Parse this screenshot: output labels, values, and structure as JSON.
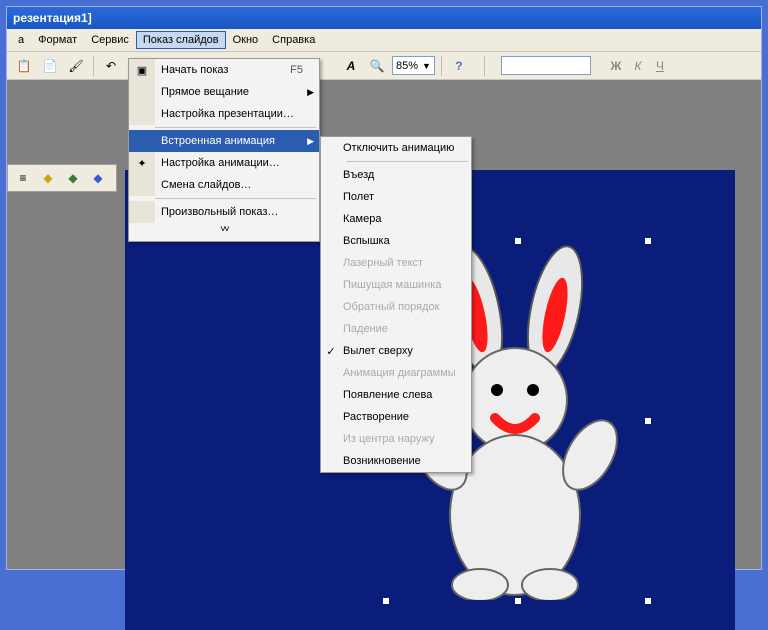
{
  "titlebar": "резентация1]",
  "menubar": {
    "items": [
      "а",
      "Формат",
      "Сервис",
      "Показ слайдов",
      "Окно",
      "Справка"
    ],
    "activeIndex": 3
  },
  "toolbar": {
    "zoom": "85%"
  },
  "dropdown1": {
    "items": [
      {
        "icon": "▣",
        "label": "Начать показ",
        "shortcut": "F5"
      },
      {
        "label": "Прямое вещание",
        "arrow": true
      },
      {
        "label": "Настройка презентации…"
      },
      {
        "sep": true
      },
      {
        "label": "Встроенная анимация",
        "arrow": true,
        "highlight": true
      },
      {
        "icon": "✦",
        "label": "Настройка анимации…"
      },
      {
        "label": "Смена слайдов…"
      },
      {
        "sep": true
      },
      {
        "label": "Произвольный показ…"
      }
    ]
  },
  "dropdown2": {
    "items": [
      {
        "label": "Отключить анимацию"
      },
      {
        "sep": true
      },
      {
        "label": "Въезд"
      },
      {
        "label": "Полет"
      },
      {
        "label": "Камера"
      },
      {
        "label": "Вспышка"
      },
      {
        "label": "Лазерный текст",
        "disabled": true
      },
      {
        "label": "Пишущая машинка",
        "disabled": true
      },
      {
        "label": "Обратный порядок",
        "disabled": true
      },
      {
        "label": "Падение",
        "disabled": true
      },
      {
        "label": "Вылет сверху",
        "checked": true
      },
      {
        "label": "Анимация диаграммы",
        "disabled": true
      },
      {
        "label": "Появление слева"
      },
      {
        "label": "Растворение"
      },
      {
        "label": "Из центра наружу",
        "disabled": true
      },
      {
        "label": "Возникновение"
      }
    ]
  },
  "format_buttons": {
    "bold": "Ж",
    "italic": "К",
    "underline": "Ч"
  }
}
